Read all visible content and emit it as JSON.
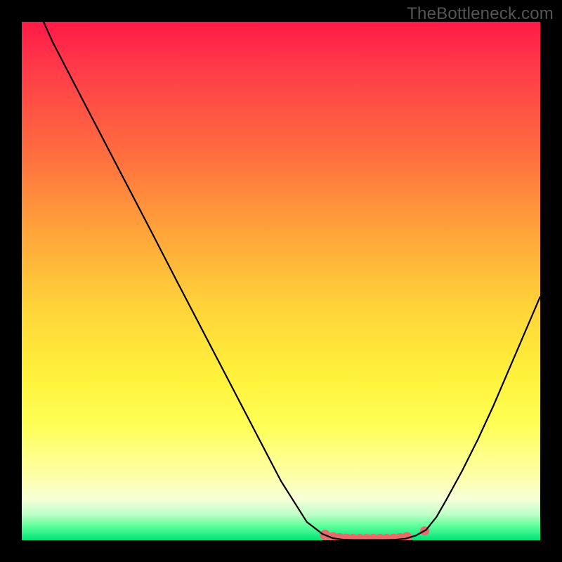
{
  "watermark": "TheBottleneck.com",
  "colors": {
    "frame": "#000000",
    "curve": "#000000",
    "marker": "#e86a6a",
    "gradient_top": "#ff1a47",
    "gradient_bottom": "#00e477"
  },
  "chart_data": {
    "type": "line",
    "title": "",
    "xlabel": "",
    "ylabel": "",
    "xlim": [
      0,
      100
    ],
    "ylim": [
      0,
      100
    ],
    "grid": false,
    "series": [
      {
        "name": "bottleneck-curve",
        "x": [
          0,
          4.2,
          6,
          10,
          15,
          20,
          25,
          30,
          35,
          40,
          45,
          50,
          55,
          58,
          60,
          62,
          64,
          66,
          68,
          70,
          72,
          74,
          76,
          78,
          80,
          82,
          85,
          88,
          91,
          94,
          97,
          100
        ],
        "values": [
          115,
          100,
          96,
          88.3,
          78.7,
          69.1,
          59.5,
          49.8,
          40.2,
          30.6,
          21.0,
          11.4,
          3.5,
          1.2,
          0.4,
          0.1,
          0.05,
          0.05,
          0.05,
          0.05,
          0.1,
          0.3,
          0.9,
          2.0,
          4.5,
          8.0,
          13.5,
          19.5,
          26.0,
          33.0,
          40.0,
          47.0
        ]
      }
    ],
    "markers": {
      "name": "flat-region",
      "points": [
        {
          "x": 58.5,
          "y": 1.0
        },
        {
          "x": 60.0,
          "y": 0.55
        },
        {
          "x": 61.3,
          "y": 0.35
        },
        {
          "x": 62.6,
          "y": 0.25
        },
        {
          "x": 63.9,
          "y": 0.2
        },
        {
          "x": 65.2,
          "y": 0.2
        },
        {
          "x": 66.5,
          "y": 0.2
        },
        {
          "x": 67.8,
          "y": 0.2
        },
        {
          "x": 69.1,
          "y": 0.2
        },
        {
          "x": 70.4,
          "y": 0.2
        },
        {
          "x": 71.7,
          "y": 0.25
        },
        {
          "x": 73.0,
          "y": 0.35
        },
        {
          "x": 74.3,
          "y": 0.55
        },
        {
          "x": 77.7,
          "y": 1.8
        }
      ]
    }
  }
}
